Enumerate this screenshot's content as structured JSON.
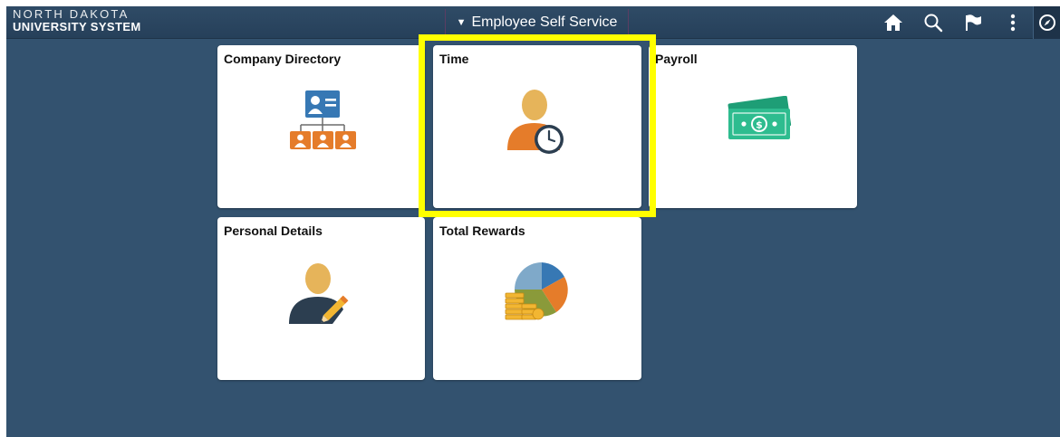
{
  "header": {
    "logo_line1": "NORTH DAKOTA",
    "logo_line2": "UNIVERSITY SYSTEM",
    "title": "Employee Self Service",
    "icons": [
      "home-icon",
      "search-icon",
      "flag-icon",
      "more-icon",
      "navbar-compass-icon"
    ]
  },
  "tiles": [
    {
      "label": "Company Directory",
      "icon": "org-chart-icon"
    },
    {
      "label": "Time",
      "icon": "person-clock-icon"
    },
    {
      "label": "Payroll",
      "icon": "money-icon"
    },
    {
      "label": "Personal Details",
      "icon": "person-pencil-icon"
    },
    {
      "label": "Total Rewards",
      "icon": "pie-coins-icon"
    }
  ],
  "colors": {
    "background": "#33526f",
    "header": "#2a4560",
    "highlight": "#ffff00",
    "orange": "#e57c2a",
    "blue": "#3778b4",
    "green": "#2ebc8f"
  }
}
